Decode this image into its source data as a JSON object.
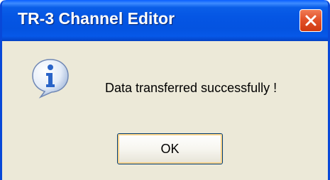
{
  "window": {
    "title": "TR-3 Channel Editor",
    "close_icon": "close-icon"
  },
  "message": {
    "icon": "information-icon",
    "text": "Data transferred successfully !"
  },
  "buttons": {
    "ok_label": "OK"
  },
  "colors": {
    "titlebar": "#0556e4",
    "dialog_background": "#ece9d8",
    "close_button": "#e2522a",
    "info_icon": "#2a64c8"
  }
}
